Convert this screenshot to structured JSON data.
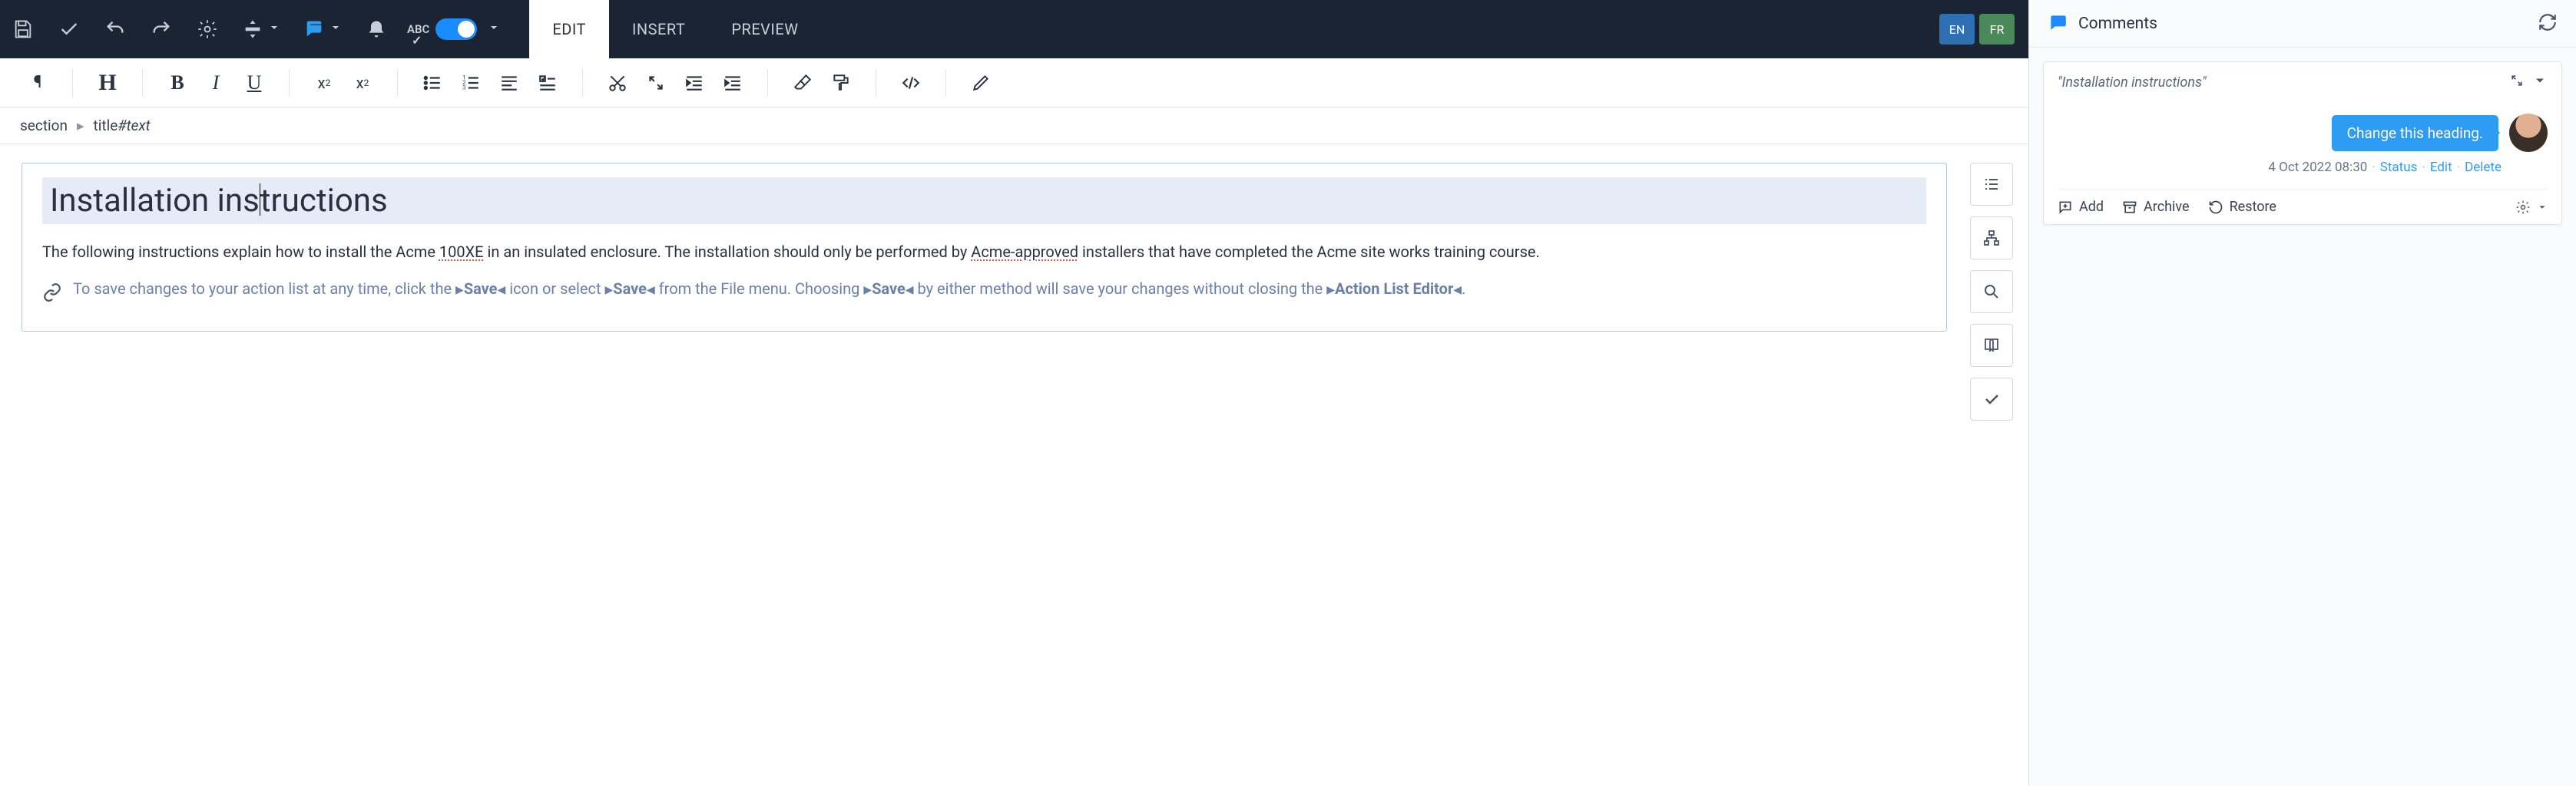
{
  "topbar": {
    "tabs": {
      "edit": "EDIT",
      "insert": "INSERT",
      "preview": "PREVIEW"
    },
    "lang": {
      "en": "EN",
      "fr": "FR"
    },
    "abc": "ABC"
  },
  "breadcrumb": {
    "section": "section",
    "title": "title",
    "text": "#text"
  },
  "doc": {
    "title_a": "Installation ins",
    "title_b": "tructions",
    "para_a": "The following instructions explain how to install the Acme ",
    "para_100xe": "100XE",
    "para_b": " in an insulated enclosure. The installation should only be performed by ",
    "para_acme": "Acme-approved",
    "para_c": " installers that have completed the Acme site works training course.",
    "linked_a": "To save changes to your action list at any time, click the ",
    "token_save": "Save",
    "linked_b": " icon or select ",
    "linked_c": " from the File menu. Choosing ",
    "linked_d": " by either method will save your changes without closing the ",
    "token_ale": "Action List Editor",
    "period": "."
  },
  "comments": {
    "panel_title": "Comments",
    "ref": "\"Installation instructions\"",
    "bubble": "Change this heading.",
    "date": "4 Oct 2022 08:30",
    "status": "Status",
    "edit": "Edit",
    "delete": "Delete",
    "add": "Add",
    "archive": "Archive",
    "restore": "Restore"
  }
}
